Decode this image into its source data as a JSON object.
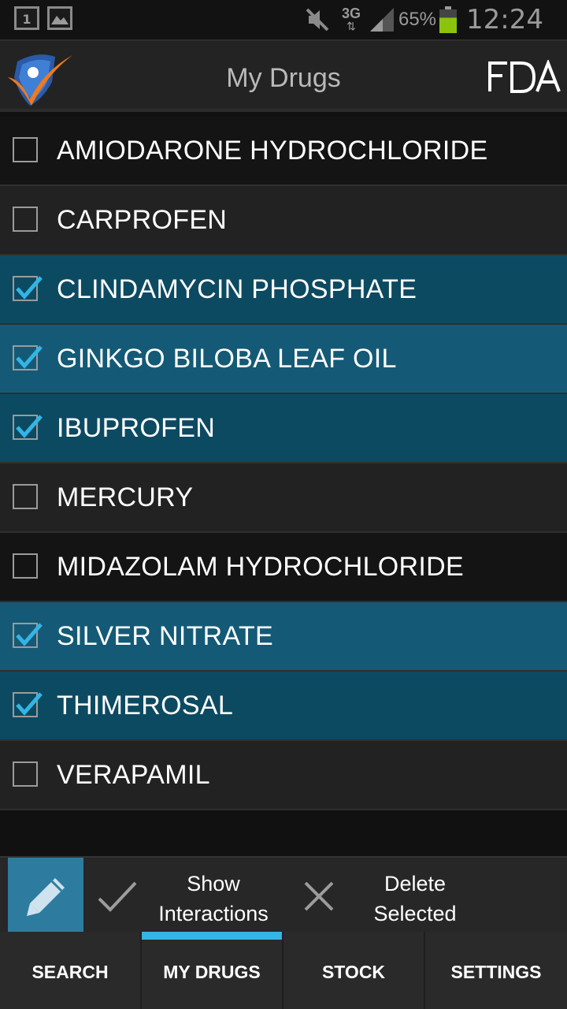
{
  "status_bar": {
    "calendar_day": "1",
    "network": "3G",
    "battery_percent": "65%",
    "battery_level": 0.65,
    "time": "12:24"
  },
  "action_bar": {
    "title": "My Drugs",
    "logo_icon": "shield-check-person-icon",
    "fda_icon": "fda-logo-icon"
  },
  "drugs": [
    {
      "name": "AMIODARONE HYDROCHLORIDE",
      "checked": false
    },
    {
      "name": "CARPROFEN",
      "checked": false
    },
    {
      "name": "CLINDAMYCIN PHOSPHATE",
      "checked": true
    },
    {
      "name": "GINKGO BILOBA LEAF OIL",
      "checked": true
    },
    {
      "name": "IBUPROFEN",
      "checked": true
    },
    {
      "name": "MERCURY",
      "checked": false
    },
    {
      "name": "MIDAZOLAM HYDROCHLORIDE",
      "checked": false
    },
    {
      "name": "SILVER NITRATE",
      "checked": true
    },
    {
      "name": "THIMEROSAL",
      "checked": true
    },
    {
      "name": "VERAPAMIL",
      "checked": false
    }
  ],
  "actions": {
    "show_line1": "Show",
    "show_line2": "Interactions",
    "delete_line1": "Delete",
    "delete_line2": "Selected"
  },
  "tabs": [
    {
      "label": "SEARCH",
      "active": false
    },
    {
      "label": "MY DRUGS",
      "active": true
    },
    {
      "label": "STOCK",
      "active": false
    },
    {
      "label": "SETTINGS",
      "active": false
    }
  ],
  "colors": {
    "accent": "#33b5e5",
    "selected_row": "#0c4a62",
    "battery": "#8bc40a"
  }
}
